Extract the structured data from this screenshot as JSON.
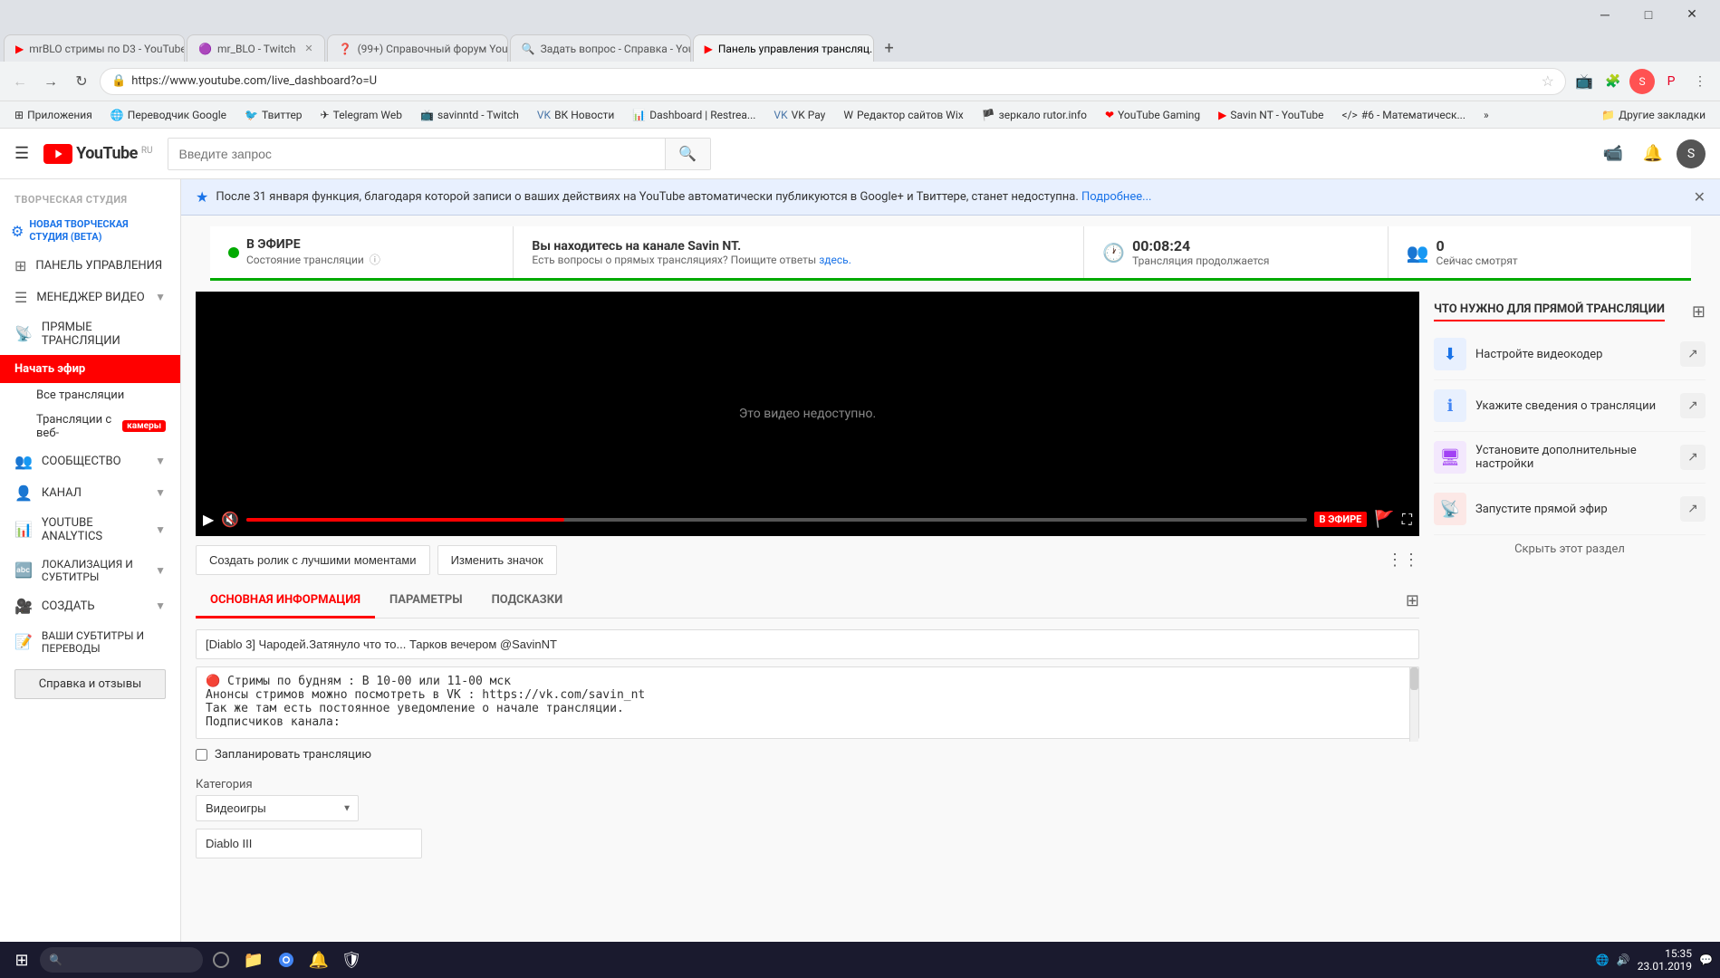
{
  "browser": {
    "tabs": [
      {
        "id": "tab1",
        "title": "mrBLO стримы по D3 - YouTube",
        "favicon": "▶",
        "active": false
      },
      {
        "id": "tab2",
        "title": "mr_BLO - Twitch",
        "favicon": "🟣",
        "active": false
      },
      {
        "id": "tab3",
        "title": "(99+) Справочный форум You...",
        "favicon": "❓",
        "active": false
      },
      {
        "id": "tab4",
        "title": "Задать вопрос - Справка - You...",
        "favicon": "❓",
        "active": false
      },
      {
        "id": "tab5",
        "title": "Панель управления трансляц...",
        "favicon": "▶",
        "active": true
      }
    ],
    "url": "https://www.youtube.com/live_dashboard?o=U",
    "bookmarks": [
      "Приложения",
      "Переводчик Google",
      "Твиттер",
      "Telegram Web",
      "savinntd - Twitch",
      "ВК Новости",
      "Dashboard | Restrea...",
      "VK Pay",
      "Редактор сайтов Wix",
      "зеркало rutor.info",
      "YouTube Gaming",
      "Savin NT - YouTube",
      "#6 - Математическ..."
    ]
  },
  "youtube": {
    "logo_text": "YouTube",
    "logo_ru": "RU",
    "search_placeholder": "Введите запрос",
    "header": {
      "studio_label": "ТВОРЧЕСКАЯ СТУДИЯ"
    }
  },
  "sidebar": {
    "studio_title": "ТВОРЧЕСКАЯ СТУДИЯ",
    "new_studio_label": "НОВАЯ ТВОРЧЕСКАЯ СТУДИЯ (BETA)",
    "items": [
      {
        "id": "dashboard",
        "label": "ПАНЕЛЬ УПРАВЛЕНИЯ",
        "icon": "⊞"
      },
      {
        "id": "video-manager",
        "label": "МЕНЕДЖЕР ВИДЕО",
        "icon": "☰",
        "has_chevron": true
      },
      {
        "id": "live",
        "label": "ПРЯМЫЕ ТРАНСЛЯЦИИ",
        "icon": "📡",
        "active": true
      },
      {
        "id": "community",
        "label": "СООБЩЕСТВО",
        "icon": "👥",
        "has_chevron": true
      },
      {
        "id": "channel",
        "label": "КАНАЛ",
        "icon": "👤",
        "has_chevron": true
      },
      {
        "id": "analytics",
        "label": "YOUTUBE ANALYTICS",
        "icon": "📊",
        "has_chevron": true
      },
      {
        "id": "localization",
        "label": "ЛОКАЛИЗАЦИЯ И СУБТИТРЫ",
        "icon": "🔤",
        "has_chevron": true
      },
      {
        "id": "create",
        "label": "СОЗДАТЬ",
        "icon": "🎥",
        "has_chevron": true
      },
      {
        "id": "subtitles",
        "label": "ВАШИ СУБТИТРЫ И ПЕРЕВОДЫ",
        "icon": "📝"
      }
    ],
    "sub_items": [
      {
        "label": "Начать эфир",
        "active": true
      },
      {
        "label": "Все трансляции"
      },
      {
        "label": "Трансляции с веб-камеры",
        "badge": "камеры"
      }
    ],
    "help_btn": "Справка и отзывы"
  },
  "notification": {
    "text": "После 31 января функция, благодаря которой записи о ваших действиях на YouTube автоматически публикуются в Google+ и Твиттере, станет недоступна.",
    "link_text": "Подробнее...",
    "icon": "★"
  },
  "stream_status": {
    "live_label": "В ЭФИРЕ",
    "status_label": "Состояние трансляции",
    "channel_title": "Вы находитесь на канале Savin NT.",
    "channel_sub": "Есть вопросы о прямых трансляциях? Поищите ответы",
    "channel_link": "здесь.",
    "time_icon": "🕐",
    "time_value": "00:08:24",
    "time_label": "Трансляция продолжается",
    "viewers_icon": "👥",
    "viewers_value": "0",
    "viewers_label": "Сейчас смотрят"
  },
  "video": {
    "unavailable_text": "Это видео недоступно.",
    "live_badge": "В ЭФИРЕ",
    "controls": {
      "play": "▶",
      "mute": "🔇",
      "fullscreen": "⛶",
      "report": "🚩"
    }
  },
  "stream_buttons": {
    "highlights": "Создать ролик с лучшими моментами",
    "thumbnail": "Изменить значок"
  },
  "tabs": {
    "items": [
      {
        "id": "main-info",
        "label": "ОСНОВНАЯ ИНФОРМАЦИЯ",
        "active": true
      },
      {
        "id": "params",
        "label": "ПАРАМЕТРЫ"
      },
      {
        "id": "hints",
        "label": "ПОДСКАЗКИ"
      }
    ]
  },
  "form": {
    "title_value": "[Diablo 3] Чародей.Затянуло что то... Тарков вечером @SavinNT",
    "description_line1": "🔴 Стримы по будням : В 10-00 или 11-00 мск",
    "description_line2": "Анонсы стримов можно посмотреть в VK : https://vk.com/savin_nt",
    "description_line3": "Так же там есть постоянное уведомление о начале трансляции.",
    "schedule_checkbox": "Запланировать трансляцию",
    "category_label": "Категория",
    "category_value": "Видеоигры",
    "game_value": "Diablo III"
  },
  "right_panel": {
    "title": "ЧТО НУЖНО ДЛЯ ПРЯМОЙ ТРАНСЛЯЦИИ",
    "items": [
      {
        "id": "encoder",
        "label": "Настройте видеокодер",
        "icon": "⬇",
        "icon_style": "blue"
      },
      {
        "id": "info",
        "label": "Укажите сведения о трансляции",
        "icon": "ℹ",
        "icon_style": "blue2"
      },
      {
        "id": "settings",
        "label": "Установите дополнительные настройки",
        "icon": "🖥",
        "icon_style": "purple"
      },
      {
        "id": "start",
        "label": "Запустите прямой эфир",
        "icon": "📡",
        "icon_style": "red"
      }
    ],
    "hide_label": "Скрыть этот раздел"
  },
  "taskbar": {
    "time": "15:35",
    "date": "23.01.2019",
    "icons": [
      "⊞",
      "🔍",
      "📁",
      "🌐",
      "📧",
      "🔔"
    ]
  }
}
